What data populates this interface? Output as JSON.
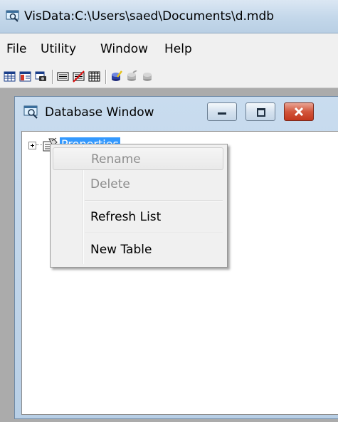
{
  "window": {
    "title": "VisData:C:\\Users\\saed\\Documents\\d.mdb",
    "icon": "database-icon"
  },
  "menu": {
    "items": [
      "File",
      "Utility",
      "Window",
      "Help"
    ]
  },
  "toolbar": {
    "icons": [
      "table-view-icon",
      "dynaset-view-icon",
      "snapshot-view-icon",
      "data-control-icon",
      "no-data-control-icon",
      "grid-view-icon",
      "begin-transaction-icon",
      "commit-icon",
      "rollback-icon"
    ]
  },
  "child_window": {
    "title": "Database Window",
    "icon": "database-icon",
    "buttons": [
      "minimize",
      "maximize",
      "close"
    ]
  },
  "tree": {
    "node_label": "Properties",
    "node_icon": "properties-icon",
    "expander": "plus"
  },
  "context_menu": {
    "items": [
      {
        "label": "Rename",
        "enabled": false,
        "highlighted": true
      },
      {
        "label": "Delete",
        "enabled": false,
        "highlighted": false
      },
      {
        "label": "Refresh List",
        "enabled": true,
        "highlighted": false
      },
      {
        "label": "New Table",
        "enabled": true,
        "highlighted": false
      }
    ]
  },
  "colors": {
    "selection": "#3399ff",
    "close_button": "#c3371d"
  }
}
